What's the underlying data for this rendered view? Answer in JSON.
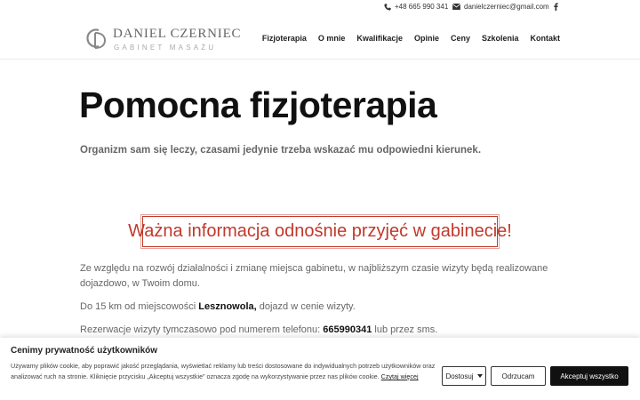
{
  "topbar": {
    "phone": "+48 665 990 341",
    "email": "danielczerniec@gmail.com"
  },
  "logo": {
    "name": "Daniel Czerniec",
    "subtitle": "Gabinet Masażu"
  },
  "nav": [
    "Fizjoterapia",
    "O mnie",
    "Kwalifikacje",
    "Opinie",
    "Ceny",
    "Szkolenia",
    "Kontakt"
  ],
  "main": {
    "title": "Pomocna fizjoterapia",
    "lead": "Organizm sam się leczy, czasami jedynie trzeba wskazać mu odpowiedni kierunek.",
    "notice": "Ważna informacja odnośnie przyjęć w gabinecie!",
    "para1_line1": "Ze względu na rozwój działalności i zmianę miejsca gabinetu, w najbliższym czasie wizyty będą realizowane",
    "para1_line2": "dojazdowo, w Twoim domu.",
    "para2_pre": "Do 15 km od miejscowości ",
    "para2_bold": "Lesznowola,",
    "para2_post": " dojazd w cenie wizyty.",
    "para3_pre": "Rezerwacje wizyty tymczasowo pod numerem telefonu: ",
    "para3_bold": "665990341",
    "para3_post": " lub przez sms."
  },
  "cookie": {
    "title": "Cenimy prywatność użytkowników",
    "text": "Używamy plików cookie, aby poprawić jakość przeglądania, wyświetlać reklamy lub treści dostosowane do indywidualnych potrzeb użytkowników oraz analizować ruch na stronie. Kliknięcie przycisku „Akceptuj wszystkie” oznacza zgodę na wykorzystywanie przez nas plików cookie. ",
    "link": "Czytaj więcej",
    "customize": "Dostosuj",
    "reject": "Odrzucam",
    "accept": "Akceptuj wszystko"
  }
}
